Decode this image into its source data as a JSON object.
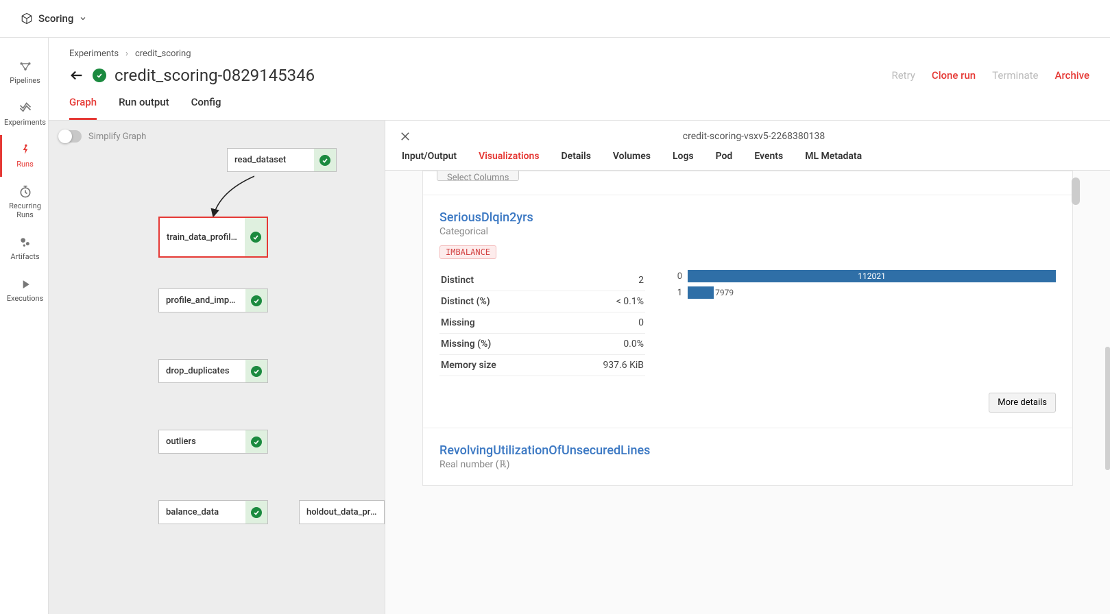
{
  "brand": "Scoring",
  "breadcrumb": {
    "a": "Experiments",
    "b": "credit_scoring"
  },
  "page_title": "credit_scoring-0829145346",
  "actions": {
    "retry": "Retry",
    "clone": "Clone run",
    "terminate": "Terminate",
    "archive": "Archive"
  },
  "tabs": {
    "graph": "Graph",
    "output": "Run output",
    "config": "Config"
  },
  "simplify_label": "Simplify Graph",
  "sidebar": {
    "pipelines": "Pipelines",
    "experiments": "Experiments",
    "runs": "Runs",
    "recurring": "Recurring Runs",
    "artifacts": "Artifacts",
    "executions": "Executions"
  },
  "nodes": {
    "read_dataset": "read_dataset",
    "train_data_profiling": "train_data_profiling",
    "profile_and_impute": "profile_and_impu...",
    "drop_duplicates": "drop_duplicates",
    "outliers": "outliers",
    "balance_data": "balance_data",
    "holdout_data_pro": "holdout_data_pro..."
  },
  "details": {
    "title": "credit-scoring-vsxv5-2268380138",
    "subtabs": {
      "io": "Input/Output",
      "viz": "Visualizations",
      "det": "Details",
      "vol": "Volumes",
      "logs": "Logs",
      "pod": "Pod",
      "events": "Events",
      "ml": "ML Metadata"
    },
    "select_columns": "Select Columns",
    "var1": {
      "name": "SeriousDlqin2yrs",
      "type": "Categorical",
      "tag": "IMBALANCE",
      "stats": [
        {
          "k": "Distinct",
          "v": "2"
        },
        {
          "k": "Distinct (%)",
          "v": "< 0.1%"
        },
        {
          "k": "Missing",
          "v": "0"
        },
        {
          "k": "Missing (%)",
          "v": "0.0%"
        },
        {
          "k": "Memory size",
          "v": "937.6 KiB"
        }
      ],
      "more_details": "More details"
    },
    "var2": {
      "name": "RevolvingUtilizationOfUnsecuredLines",
      "type": "Real number (ℝ)"
    }
  },
  "chart_data": {
    "type": "bar",
    "categories": [
      "0",
      "1"
    ],
    "values": [
      112021,
      7979
    ],
    "title": "",
    "xlabel": "",
    "ylabel": "",
    "ylim": [
      0,
      112021
    ]
  }
}
